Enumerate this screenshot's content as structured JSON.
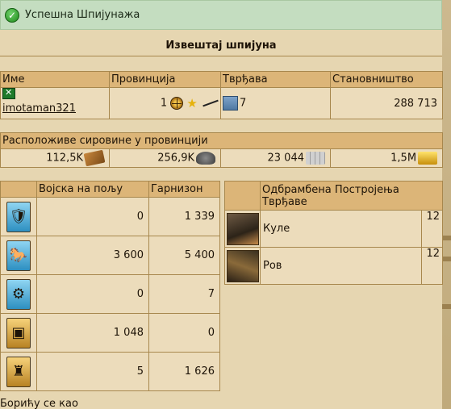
{
  "notification": {
    "text": "Успешна Шпијунажа",
    "icon": "check-icon"
  },
  "report": {
    "title": "Извештај шпијуна"
  },
  "info_table": {
    "headers": [
      "Име",
      "Провинција",
      "Тврђава",
      "Становништво"
    ],
    "player": "imotaman321",
    "province_number": "1",
    "fortress_level": "7",
    "population": "288 713"
  },
  "resources": {
    "header": "Расположиве сировине у провинцији",
    "items": [
      {
        "value": "112,5K",
        "icon": "wood-icon"
      },
      {
        "value": "256,9K",
        "icon": "iron-icon"
      },
      {
        "value": "23 044",
        "icon": "stone-icon"
      },
      {
        "value": "1,5M",
        "icon": "gold-icon"
      }
    ]
  },
  "troops": {
    "headers": [
      "Војска на пољу",
      "Гарнизон"
    ],
    "rows": [
      {
        "unit": "spearman",
        "field": "0",
        "garrison": "1 339"
      },
      {
        "unit": "cavalry",
        "field": "3 600",
        "garrison": "5 400"
      },
      {
        "unit": "catapult",
        "field": "0",
        "garrison": "7"
      },
      {
        "unit": "wagon",
        "field": "1 048",
        "garrison": "0"
      },
      {
        "unit": "militia",
        "field": "5",
        "garrison": "1 626"
      }
    ]
  },
  "defenses": {
    "header": "Одбрамбена Постројења Тврђаве",
    "rows": [
      {
        "name": "Куле",
        "level": "12"
      },
      {
        "name": "Ров",
        "level": "12"
      }
    ]
  },
  "footer_text": "Борићу се као"
}
